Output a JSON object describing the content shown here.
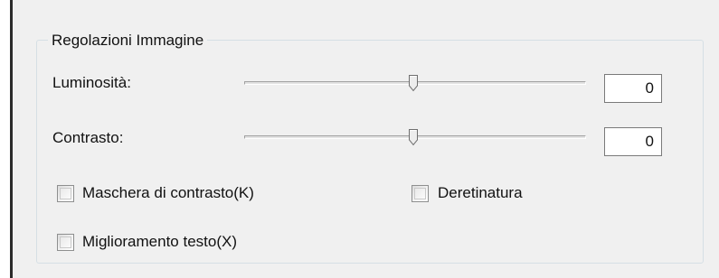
{
  "group": {
    "title": "Regolazioni Immagine"
  },
  "brightness": {
    "label": "Luminosità:",
    "value": "0",
    "slider_level": 0.5
  },
  "contrast": {
    "label": "Contrasto:",
    "value": "0",
    "slider_level": 0.5
  },
  "options": {
    "unsharp_mask": {
      "label": "Maschera di contrasto(K)",
      "checked": false
    },
    "descreening": {
      "label": "Deretinatura",
      "checked": false
    },
    "text_enhancement": {
      "label": "Miglioramento testo(X)",
      "checked": false
    }
  },
  "icons": {
    "slider_thumb": "slider-thumb-icon"
  }
}
